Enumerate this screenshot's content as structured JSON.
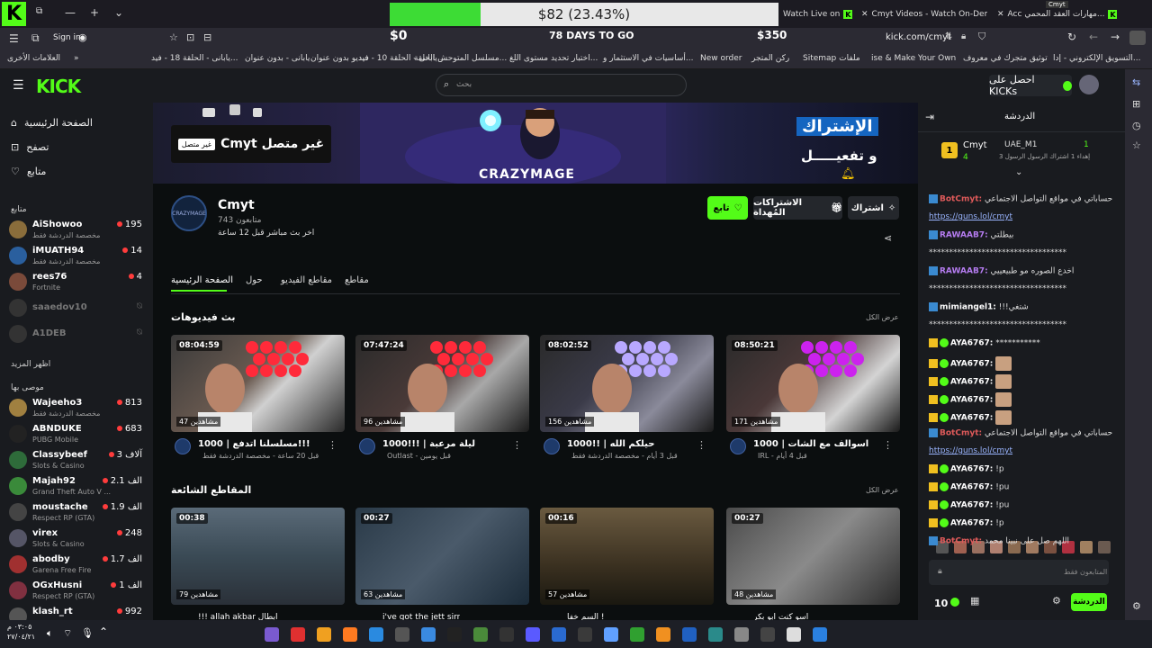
{
  "titlebar": {
    "goal_text": "$82 (23.43%)",
    "goal_percent": 23.43,
    "tabs": [
      {
        "label": "Watch Live on"
      },
      {
        "label": "Cmyt Videos - Watch On-Dem"
      },
      {
        "label": "Acc مهارات العقد المحمي..."
      }
    ],
    "tab_tooltip": "Cmyt"
  },
  "navbar": {
    "sign_in": "Sign in",
    "goal_start": "$0",
    "goal_days": "78 DAYS TO GO",
    "goal_end": "$350",
    "url": "kick.com/cmyt"
  },
  "bookmarks": [
    "العلامات الأخرى",
    "يابانى - الحلقة 18 - فيد...",
    "يابانى - بدون عنوان",
    "فيديو بدون عنوان",
    "يابانى - الحلقة 10 - فيد...",
    "مسلسل المتوحش الحلقة...",
    "اختبار تحديد مستوى اللغ...",
    "أساسيات في الاستثمار و...",
    "New order",
    "ركن المتجر",
    "Sitemap ملفات",
    "ise & Make Your Own",
    "توثيق متجرك في معروف",
    "التسويق الإلكتروني - إدا..."
  ],
  "header": {
    "search_placeholder": "بحث",
    "signup": "احصل على KICKs"
  },
  "sidebar": {
    "nav": [
      {
        "label": "الصفحة الرئيسية"
      },
      {
        "label": "تصفح"
      },
      {
        "label": "متابع"
      }
    ],
    "following_title": "متابع",
    "following": [
      {
        "name": "AiShowoo",
        "game": "مخصصة الدردشة فقط",
        "viewers": "195",
        "color": "#8a6d3b"
      },
      {
        "name": "iMUATH94",
        "game": "مخصصة الدردشة فقط",
        "viewers": "14",
        "color": "#2a5f9e"
      },
      {
        "name": "rees76",
        "game": "Fortnite",
        "viewers": "4",
        "color": "#7a4a3a"
      },
      {
        "name": "saaedov10",
        "game": "",
        "viewers": "",
        "color": "#333"
      },
      {
        "name": "A1DEB",
        "game": "",
        "viewers": "",
        "color": "#333"
      }
    ],
    "show_more": "اظهر المزيد",
    "recommended_title": "موصى بها",
    "recommended": [
      {
        "name": "Wajeeho3",
        "game": "مخصصة الدردشة فقط",
        "viewers": "813",
        "color": "#a08040"
      },
      {
        "name": "ABNDUKE",
        "game": "PUBG Mobile",
        "viewers": "683",
        "color": "#222"
      },
      {
        "name": "Classybeef",
        "game": "Slots & Casino",
        "viewers": "3 آلاف",
        "color": "#2e6b3a"
      },
      {
        "name": "Majah92",
        "game": "Grand Theft Auto V ...",
        "viewers": "2.1 الف",
        "color": "#3a8a3a"
      },
      {
        "name": "moustache",
        "game": "Respect RP (GTA)",
        "viewers": "1.9 الف",
        "color": "#444"
      },
      {
        "name": "virex",
        "game": "Slots & Casino",
        "viewers": "248",
        "color": "#556"
      },
      {
        "name": "abodby",
        "game": "Garena Free Fire",
        "viewers": "1.7 الف",
        "color": "#a03030"
      },
      {
        "name": "OGxHusni",
        "game": "Respect RP (GTA)",
        "viewers": "1 الف",
        "color": "#803040"
      },
      {
        "name": "klash_rt",
        "game": "",
        "viewers": "992",
        "color": "#555"
      }
    ]
  },
  "channel": {
    "offline_label": "غير متصل",
    "offline_text": "Cmyt غير متصل",
    "name": "Cmyt",
    "followers": "743 متابعون",
    "last_live": "اخر بث مباشر قبل 12 ساعة",
    "subscribe": "اشتراك",
    "gift_subs": "الاشتراكات المُهداة",
    "follow": "تابع",
    "tabs": [
      "الصفحة الرئيسية",
      "حول",
      "مقاطع الفيديو",
      "مقاطع"
    ],
    "banner_text_1": "الإشتراك",
    "banner_text_2": "و تفعيـــــل",
    "banner_logo": "CRAZYMAGE"
  },
  "videos": {
    "title": "بث فيديوهات",
    "view_all": "عرض الكل",
    "items": [
      {
        "duration": "08:04:59",
        "views": "47 مشاهدين",
        "title": "1000 | مسلسلنا اتدفع!!!",
        "sub": "قبل 20 ساعة - مخصصة الدردشة فقط"
      },
      {
        "duration": "07:47:24",
        "views": "96 مشاهدين",
        "title": "1000!!! | ليلة مرعبة",
        "sub": "Outlast - قبل يومين"
      },
      {
        "duration": "08:02:52",
        "views": "156 مشاهدين",
        "title": "1000!! | حيلكم الله",
        "sub": "قبل 3 أيام - مخصصة الدردشة فقط"
      },
      {
        "duration": "08:50:21",
        "views": "171 مشاهدين",
        "title": "1000 | اسوالف مع الشات",
        "sub": "IRL - قبل 4 أيام"
      }
    ]
  },
  "clips": {
    "title": "المقاطع الشائعة",
    "view_all": "عرض الكل",
    "items": [
      {
        "duration": "00:38",
        "views": "79 مشاهدين",
        "title": "!!! allah akbar أبطال"
      },
      {
        "duration": "00:27",
        "views": "63 مشاهدين",
        "title": "i've got the jett sirr"
      },
      {
        "duration": "00:16",
        "views": "57 مشاهدين",
        "title": "السم خفا !"
      },
      {
        "duration": "00:27",
        "views": "48 مشاهدين",
        "title": "أسو كنت أبو بكر"
      }
    ]
  },
  "chat": {
    "title": "الدردشة",
    "top1_name": "Cmyt",
    "top1_count": "4",
    "top2_name": "UAE_M1",
    "top2_count": "1",
    "top2_sub": "إهداء 1 اشتراك الرسول الرسول 3",
    "messages": [
      {
        "user": "BotCmyt:",
        "text": "حساباتي في مواقع التواصل الاجتماعي",
        "color": "#e05a5a"
      },
      {
        "user": "",
        "text": "https://guns.lol/cmyt",
        "color": "",
        "link": true
      },
      {
        "user": "RAWAAB7:",
        "text": "بيطلتي",
        "color": "#b57cf0"
      },
      {
        "user": "",
        "text": "**********************************",
        "color": ""
      },
      {
        "user": "RAWAAB7:",
        "text": "اخدع الصوره مو طبيعييي",
        "color": "#b57cf0"
      },
      {
        "user": "",
        "text": "**********************************",
        "color": ""
      },
      {
        "user": "mimiangel1:",
        "text": "!!!شتغي",
        "color": "#ffffff"
      },
      {
        "user": "",
        "text": "**********************************",
        "color": ""
      },
      {
        "user": "AYA6767:",
        "text": "***********",
        "color": "#ffffff"
      },
      {
        "user": "AYA6767:",
        "text": "",
        "color": "#ffffff"
      },
      {
        "user": "AYA6767:",
        "text": "",
        "color": "#ffffff"
      },
      {
        "user": "AYA6767:",
        "text": "",
        "color": "#ffffff"
      },
      {
        "user": "AYA6767:",
        "text": "",
        "color": "#ffffff"
      },
      {
        "user": "BotCmyt:",
        "text": "حساباتي في مواقع التواصل الاجتماعي",
        "color": "#e05a5a"
      },
      {
        "user": "",
        "text": "https://guns.lol/cmyt",
        "color": "",
        "link": true
      },
      {
        "user": "AYA6767:",
        "text": "!p",
        "color": "#ffffff"
      },
      {
        "user": "AYA6767:",
        "text": "!pu",
        "color": "#ffffff"
      },
      {
        "user": "AYA6767:",
        "text": "!pu",
        "color": "#ffffff"
      },
      {
        "user": "AYA6767:",
        "text": "!p",
        "color": "#ffffff"
      },
      {
        "user": "BotCmyt:",
        "text": "اللهم صل على نبينا محمد",
        "color": "#e05a5a"
      }
    ],
    "input_placeholder": "المتابعون فقط",
    "points": "10",
    "send": "الدردشة"
  },
  "taskbar": {
    "time": "٠٣:٠٥ م",
    "date": "٢٧/٠٤/٢١"
  }
}
